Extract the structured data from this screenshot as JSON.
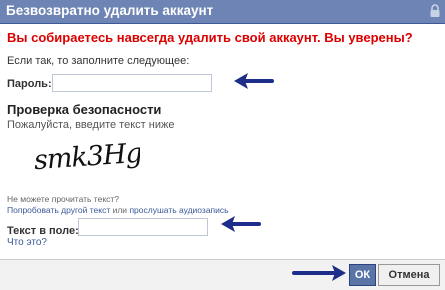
{
  "dialog": {
    "title": "Безвозвратно удалить аккаунт",
    "warning": "Вы собираетесь навсегда удалить свой аккаунт. Вы уверены?",
    "instruction": "Если так, то заполните следующее:"
  },
  "password": {
    "label": "Пароль:",
    "value": ""
  },
  "security": {
    "heading": "Проверка безопасности",
    "subtext": "Пожалуйста, введите текст ниже",
    "captcha_text": "smk3Hg",
    "cant_read": "Не можете прочитать текст?",
    "try_other": "Попробовать другой текст",
    "or": "или",
    "listen": "прослушать аудиозапись",
    "field_label": "Текст в поле:",
    "field_value": "",
    "what_is": "Что это?"
  },
  "footer": {
    "ok_label": "ОК",
    "cancel_label": "Отмена"
  },
  "colors": {
    "title_bar": "#6d84b4",
    "warning_text": "#dd0000",
    "link": "#3b5998",
    "annotation_arrow": "#1f2d8a"
  },
  "icons": [
    "lock-icon",
    "arrow-pointer-icon"
  ]
}
